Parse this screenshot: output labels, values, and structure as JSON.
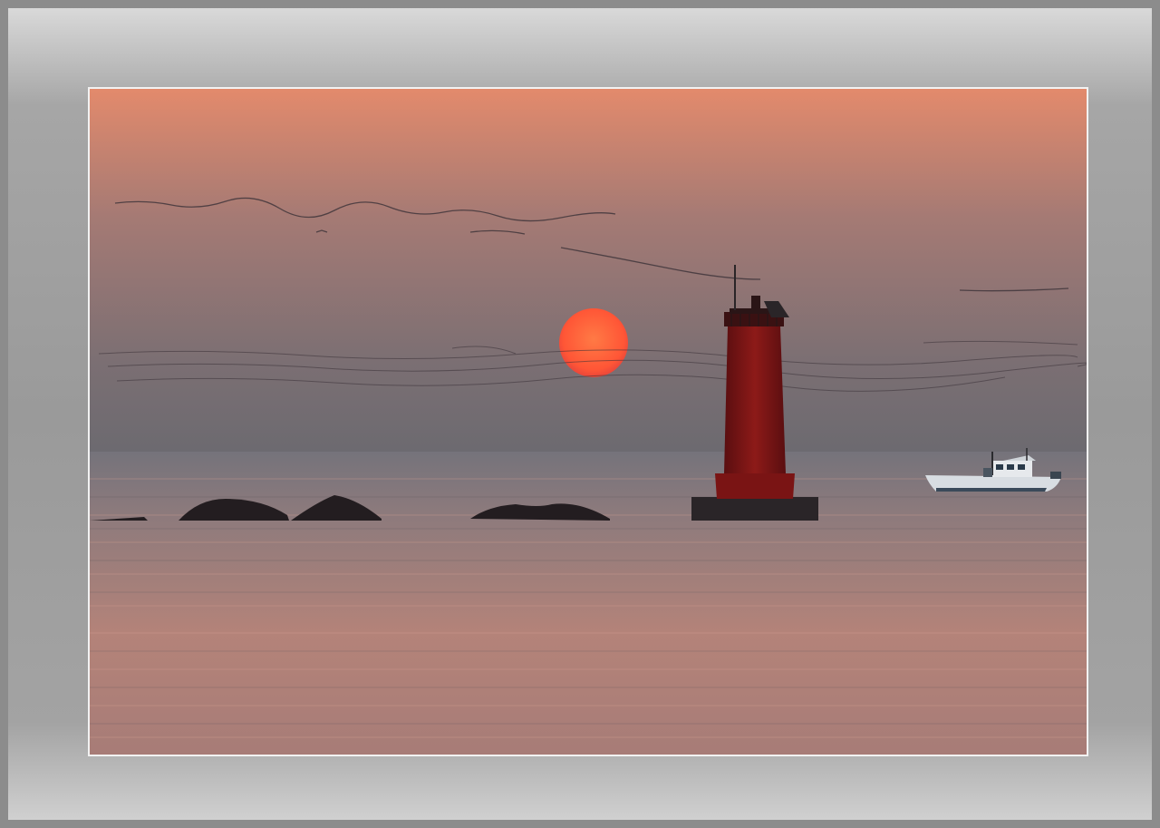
{
  "scene": {
    "subject": "sunset-over-sea",
    "elements": [
      "sun",
      "lighthouse",
      "fishing-boat",
      "rocks",
      "bird-flocks",
      "sea"
    ]
  },
  "colors": {
    "frame_mat": "#a3a3a3",
    "frame_border": "#8c8c8c",
    "photo_border": "#f2f2f2",
    "sky_top": "#e0896b",
    "sky_mid": "#9a7775",
    "sky_horizon": "#6f6b71",
    "sun": "#ff5a3a",
    "lighthouse": "#7a1414",
    "sea": "#8a7a7c",
    "sea_reflect": "#c98a78"
  }
}
